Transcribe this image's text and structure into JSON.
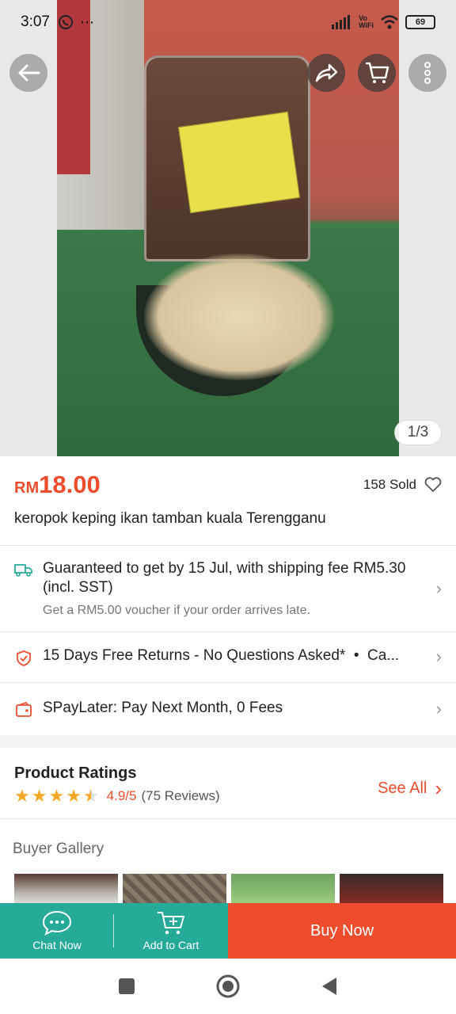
{
  "status_bar": {
    "time": "3:07",
    "notifications": "⋯",
    "battery": "69",
    "vowifi_line1": "Vo",
    "vowifi_line2": "WiFi"
  },
  "hero": {
    "page_indicator": "1/3"
  },
  "product": {
    "currency": "RM",
    "price": "18.00",
    "sold": "158 Sold",
    "title": "keropok keping ikan tamban kuala Terengganu"
  },
  "shipping": {
    "main": "Guaranteed to get by 15 Jul, with shipping fee RM5.30 (incl. SST)",
    "sub": "Get a RM5.00 voucher if your order arrives late."
  },
  "returns": {
    "text": "15 Days Free Returns - No Questions Asked*  •  Ca..."
  },
  "spaylater": {
    "text": "SPayLater: Pay Next Month, 0 Fees"
  },
  "ratings": {
    "title": "Product Ratings",
    "stars": 4.5,
    "score": "4.9/5",
    "count": "(75 Reviews)",
    "see_all": "See All"
  },
  "gallery": {
    "title": "Buyer Gallery"
  },
  "bottom_bar": {
    "chat_now": "Chat Now",
    "add_to_cart": "Add to Cart",
    "buy_now": "Buy Now"
  },
  "colors": {
    "accent": "#ee4d2d",
    "teal": "#26aa99",
    "star": "#f5a623"
  }
}
